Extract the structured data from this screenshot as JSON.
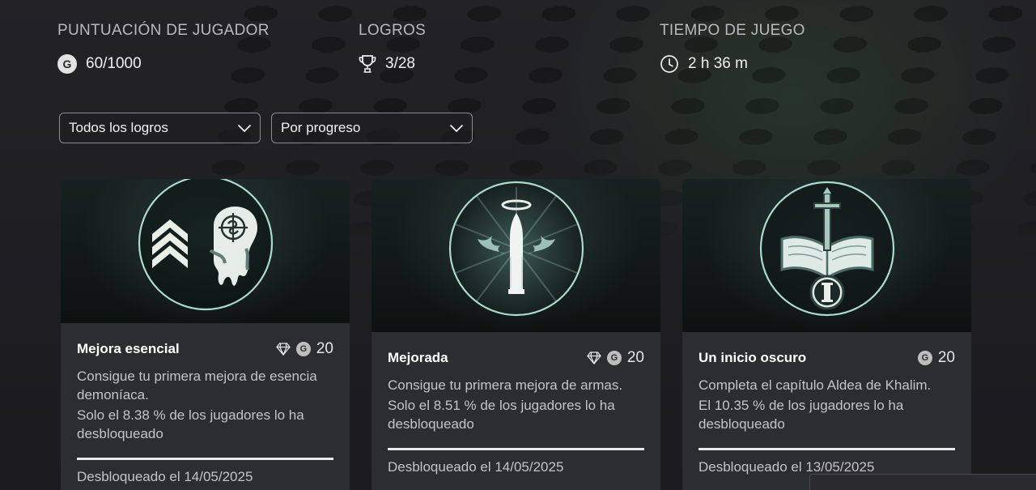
{
  "stats": {
    "score": {
      "label": "PUNTUACIÓN DE JUGADOR",
      "badge": "G",
      "value": "60/1000"
    },
    "achievements": {
      "label": "LOGROS",
      "value": "3/28"
    },
    "playtime": {
      "label": "TIEMPO DE JUEGO",
      "value": "2 h 36 m"
    }
  },
  "filters": {
    "type": {
      "selected": "Todos los logros"
    },
    "sort": {
      "selected": "Por progreso"
    }
  },
  "cards": [
    {
      "title": "Mejora esencial",
      "badge": "G",
      "score": "20",
      "has_rare_icon": true,
      "description": "Consigue tu primera mejora de esencia demoníaca.",
      "rarity": "Solo el 8.38 % de los jugadores lo ha desbloqueado",
      "date": "Desbloqueado el 14/05/2025"
    },
    {
      "title": "Mejorada",
      "badge": "G",
      "score": "20",
      "has_rare_icon": true,
      "description": "Consigue tu primera mejora de armas.",
      "rarity": "Solo el 8.51 % de los jugadores lo ha desbloqueado",
      "date": "Desbloqueado el 14/05/2025"
    },
    {
      "title": "Un inicio oscuro",
      "badge": "G",
      "score": "20",
      "has_rare_icon": false,
      "description": "Completa el capítulo Aldea de Khalim.",
      "rarity": "El 10.35 % de los jugadores lo ha desbloqueado",
      "date": "Desbloqueado el 13/05/2025"
    }
  ],
  "colors": {
    "background": "#1c1c1f",
    "card": "#2c2d30",
    "accent_teal": "#9fd6c8"
  }
}
